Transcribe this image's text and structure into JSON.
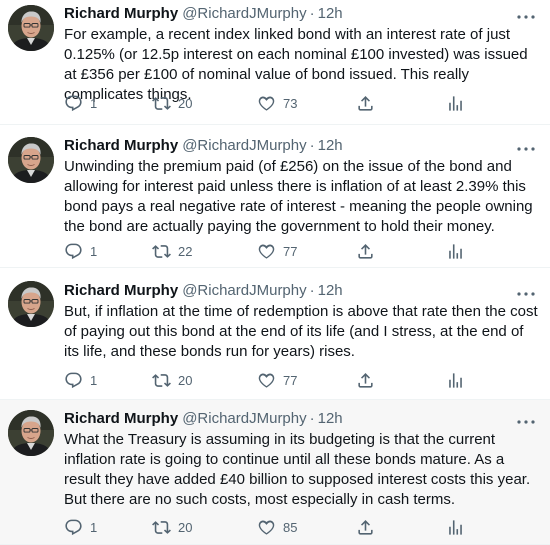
{
  "author": {
    "name": "Richard Murphy",
    "handle": "@RichardJMurphy",
    "separator": "·"
  },
  "icons": {
    "reply": "reply-icon",
    "retweet": "retweet-icon",
    "like": "like-icon",
    "share": "share-icon",
    "analytics": "analytics-icon",
    "more": "more-icon"
  },
  "colors": {
    "text": "#0f1419",
    "secondary": "#536471",
    "divider": "#eff3f4",
    "highlight": "#f7f7f7"
  },
  "tweets": [
    {
      "time": "12h",
      "text": "For example, a recent index linked bond with an interest rate of just 0.125% (or 12.5p interest on each nominal £100 invested) was issued at £356 per £100 of nominal value of bond issued. This really complicates things.",
      "replies": "1",
      "retweets": "20",
      "likes": "73"
    },
    {
      "time": "12h",
      "text": "Unwinding the premium paid (of £256) on the issue of the bond and allowing for interest paid unless there is inflation of at least 2.39% this bond pays a real negative rate of interest - meaning the people owning the bond are actually paying the government to hold their money.",
      "replies": "1",
      "retweets": "22",
      "likes": "77"
    },
    {
      "time": "12h",
      "text": "But, if inflation at the time of redemption is above that rate then the cost of paying out this bond at the end of its life (and I stress, at the end of its life, and these bonds run for years) rises.",
      "replies": "1",
      "retweets": "20",
      "likes": "77"
    },
    {
      "time": "12h",
      "text": "What the Treasury is assuming in its budgeting is that the current inflation rate is going to continue until all these bonds mature. As a result they have added £40 billion to supposed interest costs this year. But there are no such costs, most especially in cash terms.",
      "replies": "1",
      "retweets": "20",
      "likes": "85"
    }
  ]
}
